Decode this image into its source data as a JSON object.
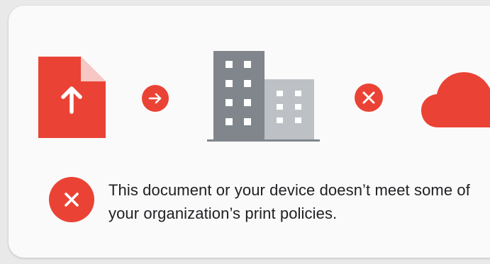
{
  "colors": {
    "background": "#e9e9e9",
    "card": "#fafafa",
    "accent_red": "#ea4335",
    "doc_fold": "#f6c7c3",
    "building_dark": "#80868b",
    "building_light": "#bdc1c6",
    "window": "#ffffff",
    "text": "#202124"
  },
  "icons": {
    "document": "document-upload-icon",
    "arrow": "arrow-right-icon",
    "building": "office-building-icon",
    "blocked": "close-circle-icon",
    "cloud": "cloud-icon",
    "message": "error-circle-icon"
  },
  "message": {
    "text": "This document or your device doesn’t meet some of your organization’s print policies."
  }
}
